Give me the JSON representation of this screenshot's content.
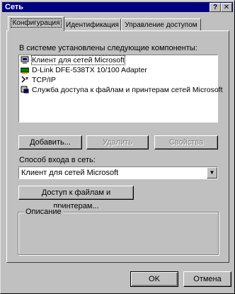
{
  "window": {
    "title": "Сеть",
    "help_glyph": "?",
    "close_glyph": "✕"
  },
  "tabs": [
    {
      "label": "Конфигурация",
      "active": true
    },
    {
      "label": "Идентификация",
      "active": false
    },
    {
      "label": "Управление доступом",
      "active": false
    }
  ],
  "components": {
    "heading": "В системе установлены следующие компоненты:",
    "items": [
      {
        "label": "Клиент для сетей Microsoft",
        "icon": "client-icon"
      },
      {
        "label": "D-Link DFE-538TX 10/100 Adapter",
        "icon": "network-adapter-icon"
      },
      {
        "label": "TCP/IP",
        "icon": "protocol-icon"
      },
      {
        "label": "Служба доступа к файлам и принтерам сетей Microsoft",
        "icon": "service-icon"
      }
    ]
  },
  "buttons": {
    "add": "Добавить...",
    "remove": "Удалить",
    "properties": "Свойства",
    "file_printer_sharing": "Доступ к файлам и принтерам...",
    "ok": "OK",
    "cancel": "Отмена"
  },
  "logon": {
    "label": "Способ входа в сеть:",
    "value": "Клиент для сетей Microsoft"
  },
  "description": {
    "legend": "Описание"
  },
  "colors": {
    "face": "#c0c0c0",
    "titlebar": "#000080"
  }
}
